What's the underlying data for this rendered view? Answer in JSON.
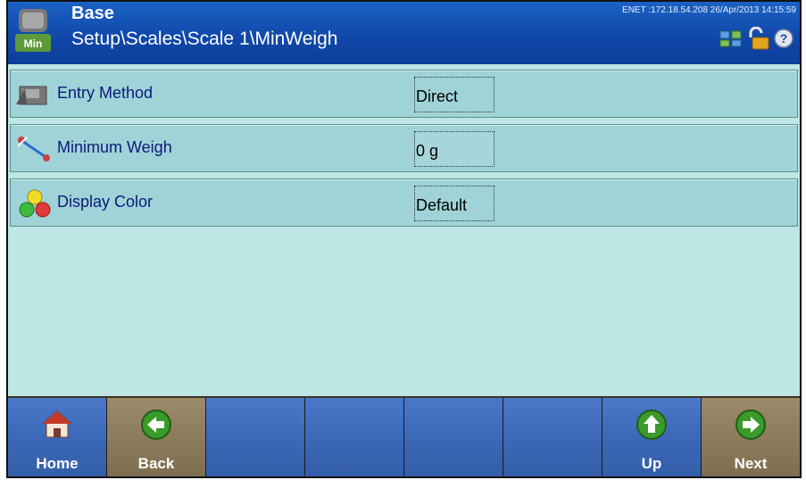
{
  "header": {
    "title": "Base",
    "path": "Setup\\Scales\\Scale 1\\MinWeigh",
    "status": "ENET :172.18.54.208  26/Apr/2013 14:15:59",
    "icons": [
      "min-weigh-icon",
      "network-icon",
      "unlock-icon",
      "help-icon"
    ]
  },
  "rows": [
    {
      "label": "Entry Method",
      "value": "Direct",
      "icon": "entry-method-icon"
    },
    {
      "label": "Minimum Weigh",
      "value": "0 g",
      "icon": "minimum-weigh-icon"
    },
    {
      "label": "Display Color",
      "value": "Default",
      "icon": "display-color-icon"
    }
  ],
  "footer": {
    "buttons": [
      {
        "label": "Home",
        "icon": "home-icon"
      },
      {
        "label": "Back",
        "icon": "back-arrow-icon"
      },
      {
        "label": "",
        "icon": ""
      },
      {
        "label": "",
        "icon": ""
      },
      {
        "label": "",
        "icon": ""
      },
      {
        "label": "",
        "icon": ""
      },
      {
        "label": "Up",
        "icon": "up-arrow-icon"
      },
      {
        "label": "Next",
        "icon": "next-arrow-icon"
      }
    ]
  },
  "colors": {
    "header_bg": "#1047a8",
    "content_bg": "#bde6e4",
    "row_bg": "#9fd3d7",
    "footer_blue": "#3c68b8",
    "footer_tan": "#8d7c5c"
  }
}
